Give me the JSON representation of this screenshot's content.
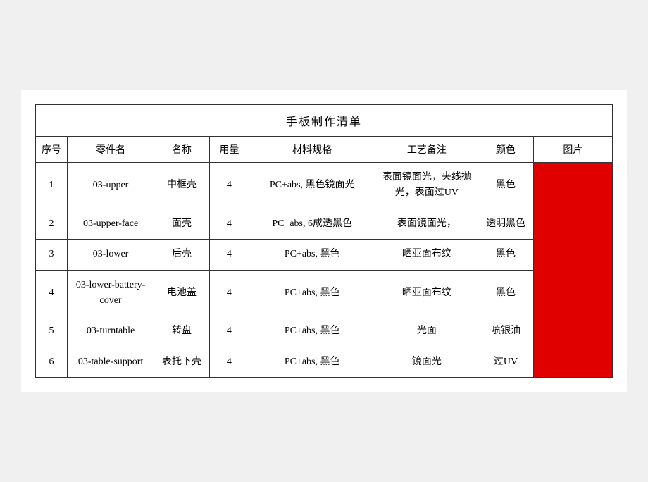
{
  "title": "手板制作清单",
  "headers": {
    "seq": "序号",
    "part_code": "零件名",
    "name": "名称",
    "qty": "用量",
    "spec": "材料规格",
    "process": "工艺备注",
    "color": "颜色",
    "image": "图片"
  },
  "rows": [
    {
      "seq": "1",
      "part_code": "03-upper",
      "name": "中框壳",
      "qty": "4",
      "spec": "PC+abs, 黑色镜面光",
      "process": "表面镜面光，夹线抛光，表面过UV",
      "color": "黑色"
    },
    {
      "seq": "2",
      "part_code": "03-upper-face",
      "name": "面壳",
      "qty": "4",
      "spec": "PC+abs, 6成透黑色",
      "process": "表面镜面光，",
      "color": "透明黑色"
    },
    {
      "seq": "3",
      "part_code": "03-lower",
      "name": "后壳",
      "qty": "4",
      "spec": "PC+abs, 黑色",
      "process": "晒亚面布纹",
      "color": "黑色"
    },
    {
      "seq": "4",
      "part_code": "03-lower-battery-cover",
      "name": "电池盖",
      "qty": "4",
      "spec": "PC+abs, 黑色",
      "process": "晒亚面布纹",
      "color": "黑色"
    },
    {
      "seq": "5",
      "part_code": "03-turntable",
      "name": "转盘",
      "qty": "4",
      "spec": "PC+abs, 黑色",
      "process": "光面",
      "color": "喷银油"
    },
    {
      "seq": "6",
      "part_code": "03-table-support",
      "name": "表托下壳",
      "qty": "4",
      "spec": "PC+abs, 黑色",
      "process": "镜面光",
      "color": "过UV"
    }
  ]
}
